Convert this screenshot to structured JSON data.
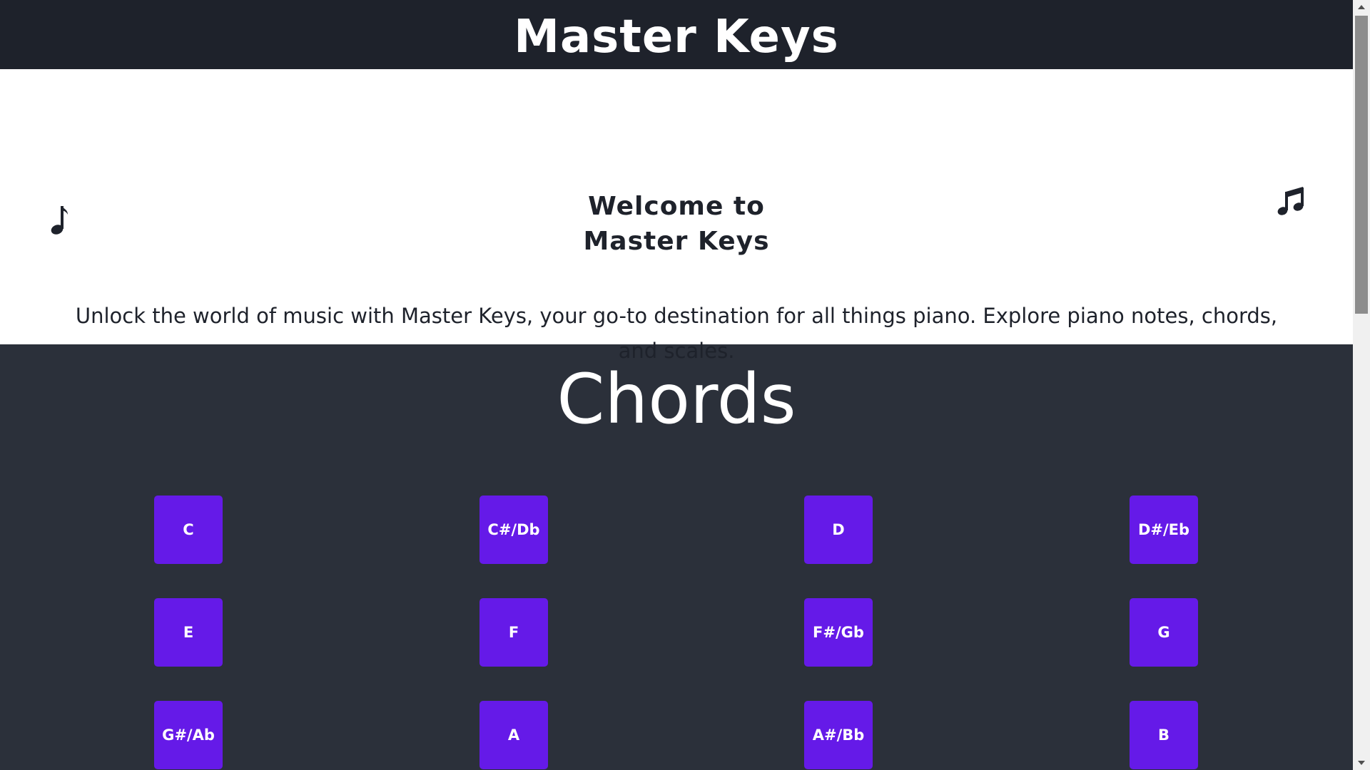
{
  "header": {
    "title": "Master Keys"
  },
  "hero": {
    "left_icon": "eighth-note-icon",
    "right_icon": "beamed-notes-icon",
    "welcome_line1": "Welcome to",
    "welcome_line2": "Master Keys",
    "tagline": "Unlock the world of music with Master Keys, your go-to destination for all things piano. Explore piano notes, chords, and scales."
  },
  "chords": {
    "heading": "Chords",
    "items": [
      {
        "label": "C"
      },
      {
        "label": "C#/Db"
      },
      {
        "label": "D"
      },
      {
        "label": "D#/Eb"
      },
      {
        "label": "E"
      },
      {
        "label": "F"
      },
      {
        "label": "F#/Gb"
      },
      {
        "label": "G"
      },
      {
        "label": "G#/Ab"
      },
      {
        "label": "A"
      },
      {
        "label": "A#/Bb"
      },
      {
        "label": "B"
      }
    ]
  },
  "colors": {
    "header_bg": "#1e222b",
    "page_bg": "#2b303a",
    "hero_bg": "#ffffff",
    "chord_button": "#651ae8",
    "text_dark": "#1e222b",
    "text_light": "#ffffff"
  }
}
